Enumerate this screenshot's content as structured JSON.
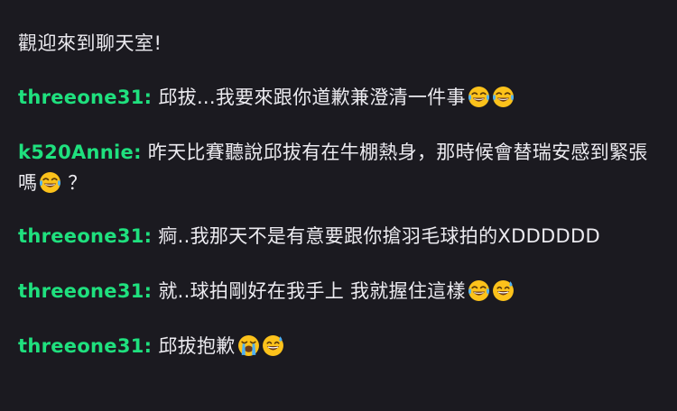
{
  "chat": {
    "welcome": "觀迎來到聊天室!",
    "messages": [
      {
        "user": "threeone31:",
        "text": "邱拔...我要來跟你道歉兼澄清一件事",
        "emojis": [
          "tears-of-joy-emoji",
          "tears-of-joy-emoji"
        ],
        "after": ""
      },
      {
        "user": "k520Annie:",
        "text": "昨天比賽聽說邱拔有在牛棚熱身，那時候會替瑞安感到緊張嗎",
        "emojis": [
          "tears-of-joy-emoji"
        ],
        "after": " ？"
      },
      {
        "user": "threeone31:",
        "text": "痾..我那天不是有意要跟你搶羽毛球拍的XDDDDDD",
        "emojis": [],
        "after": ""
      },
      {
        "user": "threeone31:",
        "text": "就..球拍剛好在我手上 我就握住這樣",
        "emojis": [
          "tears-of-joy-emoji",
          "grinning-sweat-emoji"
        ],
        "after": ""
      },
      {
        "user": "threeone31:",
        "text": "邱拔抱歉",
        "emojis": [
          "loudly-crying-emoji",
          "grinning-sweat-emoji"
        ],
        "after": ""
      }
    ]
  },
  "colors": {
    "background": "#1b1a20",
    "username": "#1fe07e",
    "text": "#ecebf0"
  }
}
